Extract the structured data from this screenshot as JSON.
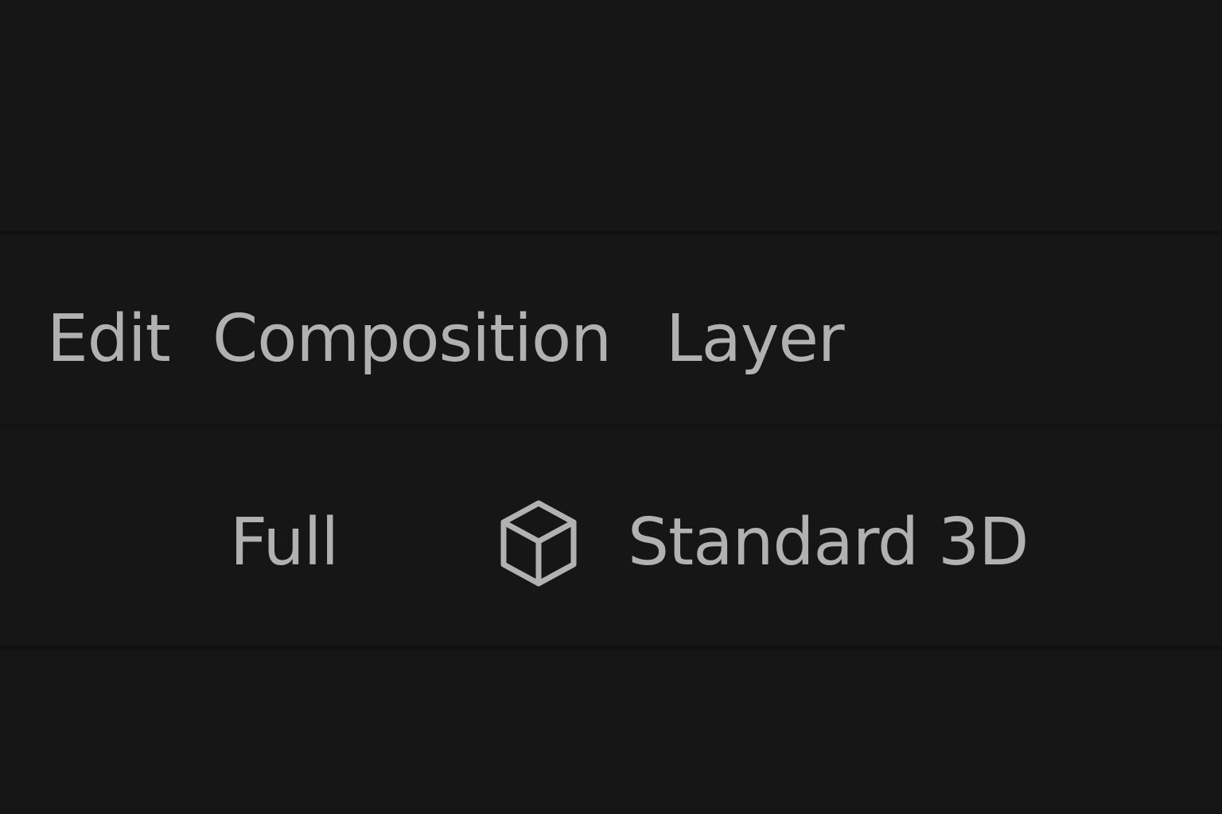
{
  "menu": {
    "items": [
      "Edit",
      "Composition",
      "Layer"
    ]
  },
  "toolbar": {
    "resolution": "Full",
    "renderer": "Standard 3D",
    "renderer_icon": "cube-icon"
  },
  "colors": {
    "background": "#151515",
    "panel": "#161616",
    "text": "#b1b1b1",
    "divider": "#111111"
  }
}
